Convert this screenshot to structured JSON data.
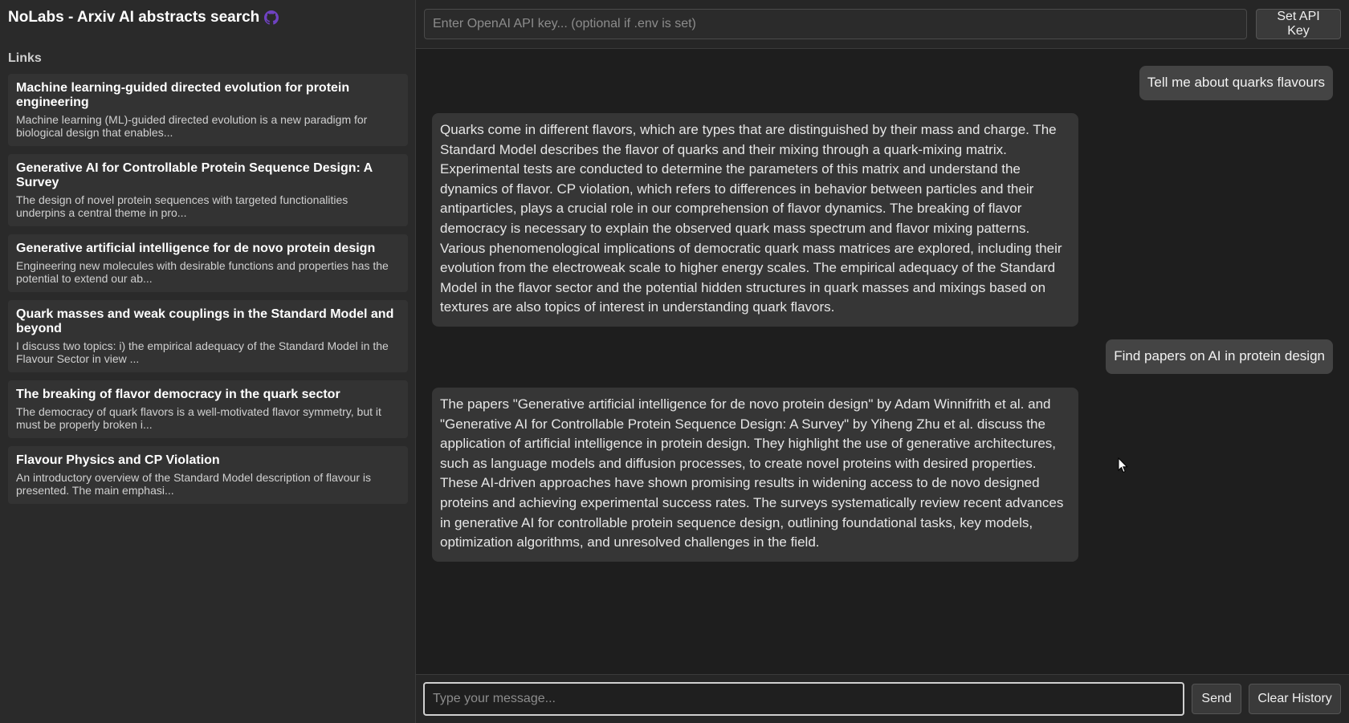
{
  "app": {
    "title": "NoLabs - Arxiv AI abstracts search"
  },
  "sidebar": {
    "links_heading": "Links",
    "papers": [
      {
        "title": "Machine learning-guided directed evolution for protein engineering",
        "abstract": "Machine learning (ML)-guided directed evolution is a new paradigm for biological design that enables..."
      },
      {
        "title": "Generative AI for Controllable Protein Sequence Design: A Survey",
        "abstract": "The design of novel protein sequences with targeted functionalities underpins a central theme in pro..."
      },
      {
        "title": "Generative artificial intelligence for de novo protein design",
        "abstract": "Engineering new molecules with desirable functions and properties has the potential to extend our ab..."
      },
      {
        "title": "Quark masses and weak couplings in the Standard Model and beyond",
        "abstract": "I discuss two topics: i) the empirical adequacy of the Standard Model in the Flavour Sector in view ..."
      },
      {
        "title": "The breaking of flavor democracy in the quark sector",
        "abstract": "The democracy of quark flavors is a well-motivated flavor symmetry, but it must be properly broken i..."
      },
      {
        "title": "Flavour Physics and CP Violation",
        "abstract": "An introductory overview of the Standard Model description of flavour is presented. The main emphasi..."
      }
    ]
  },
  "api": {
    "placeholder": "Enter OpenAI API key... (optional if .env is set)",
    "value": "",
    "button_label": "Set API Key"
  },
  "chat": {
    "messages": [
      {
        "role": "user",
        "text": "Tell me about quarks flavours"
      },
      {
        "role": "assistant",
        "text": "Quarks come in different flavors, which are types that are distinguished by their mass and charge. The Standard Model describes the flavor of quarks and their mixing through a quark-mixing matrix. Experimental tests are conducted to determine the parameters of this matrix and understand the dynamics of flavor. CP violation, which refers to differences in behavior between particles and their antiparticles, plays a crucial role in our comprehension of flavor dynamics. The breaking of flavor democracy is necessary to explain the observed quark mass spectrum and flavor mixing patterns. Various phenomenological implications of democratic quark mass matrices are explored, including their evolution from the electroweak scale to higher energy scales. The empirical adequacy of the Standard Model in the flavor sector and the potential hidden structures in quark masses and mixings based on textures are also topics of interest in understanding quark flavors."
      },
      {
        "role": "user",
        "text": "Find papers on AI in protein design"
      },
      {
        "role": "assistant",
        "text": "The papers \"Generative artificial intelligence for de novo protein design\" by Adam Winnifrith et al. and \"Generative AI for Controllable Protein Sequence Design: A Survey\" by Yiheng Zhu et al. discuss the application of artificial intelligence in protein design. They highlight the use of generative architectures, such as language models and diffusion processes, to create novel proteins with desired properties. These AI-driven approaches have shown promising results in widening access to de novo designed proteins and achieving experimental success rates. The surveys systematically review recent advances in generative AI for controllable protein sequence design, outlining foundational tasks, key models, optimization algorithms, and unresolved challenges in the field."
      }
    ]
  },
  "composer": {
    "placeholder": "Type your message...",
    "value": "",
    "send_label": "Send",
    "clear_label": "Clear History"
  },
  "colors": {
    "background": "#1e1e1e",
    "sidebar": "#2a2a2a",
    "card": "#333333",
    "user_bubble": "#444444",
    "bot_bubble": "#363636",
    "github_icon": "#6f42c1"
  },
  "icons": {
    "github": "github-icon",
    "cursor": "mouse-pointer-icon"
  }
}
